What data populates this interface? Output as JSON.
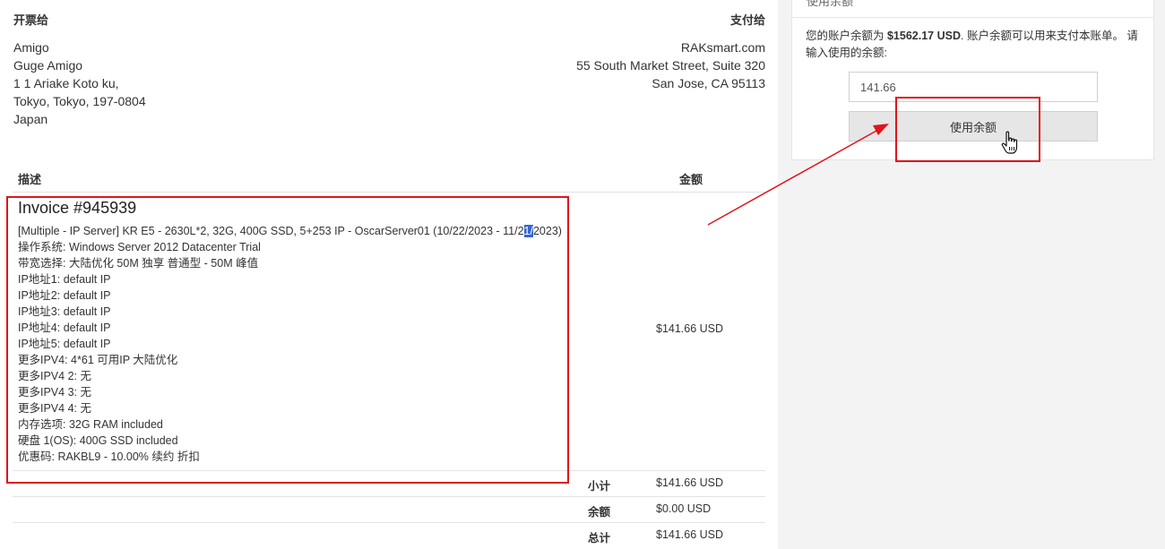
{
  "invoice_to": {
    "label": "开票给",
    "lines": [
      "Amigo",
      "Guge Amigo",
      "1 1 Ariake Koto ku,",
      "Tokyo, Tokyo, 197-0804",
      "Japan"
    ]
  },
  "pay_to": {
    "label": "支付给",
    "lines": [
      "RAKsmart.com",
      "55 South Market Street, Suite 320",
      "San Jose, CA 95113"
    ]
  },
  "table": {
    "col_description": "描述",
    "col_amount": "金额"
  },
  "item": {
    "title": "Invoice #945939",
    "first_line_before": "[Multiple - IP Server] KR E5 - 2630L*2, 32G, 400G SSD, 5+253 IP - OscarServer01 (10/22/2023 - 11/2",
    "first_line_selected": "1/",
    "first_line_after": "2023)",
    "lines": [
      "操作系统: Windows Server 2012 Datacenter Trial",
      "带宽选择: 大陆优化 50M 独享 普通型 - 50M 峰值",
      "IP地址1: default IP",
      "IP地址2: default IP",
      "IP地址3: default IP",
      "IP地址4: default IP",
      "IP地址5: default IP",
      "更多IPV4: 4*61 可用IP 大陆优化",
      "更多IPV4 2: 无",
      "更多IPV4 3: 无",
      "更多IPV4 4: 无",
      "内存选项: 32G RAM included",
      "硬盘 1(OS): 400G SSD included",
      "优惠码: RAKBL9 - 10.00% 续约 折扣"
    ],
    "amount": "$141.66 USD"
  },
  "summary": [
    {
      "label": "小计",
      "value": "$141.66 USD"
    },
    {
      "label": "余额",
      "value": "$0.00 USD"
    },
    {
      "label": "总计",
      "value": "$141.66 USD"
    }
  ],
  "credit_panel": {
    "title": "使用余额",
    "text_before": "您的账户余额为 ",
    "balance": "$1562.17 USD",
    "text_after": ". 账户余额可以用来支付本账单。 请输入使用的余额:",
    "input_value": "141.66",
    "button_label": "使用余额"
  },
  "colors": {
    "annotation_red": "#e0141b",
    "selection_blue": "#3367d6",
    "sidebar_bg": "#f3f3f3"
  },
  "icons": {
    "cursor": "hand-pointer-icon",
    "arrow": "red-arrow-annotation"
  }
}
